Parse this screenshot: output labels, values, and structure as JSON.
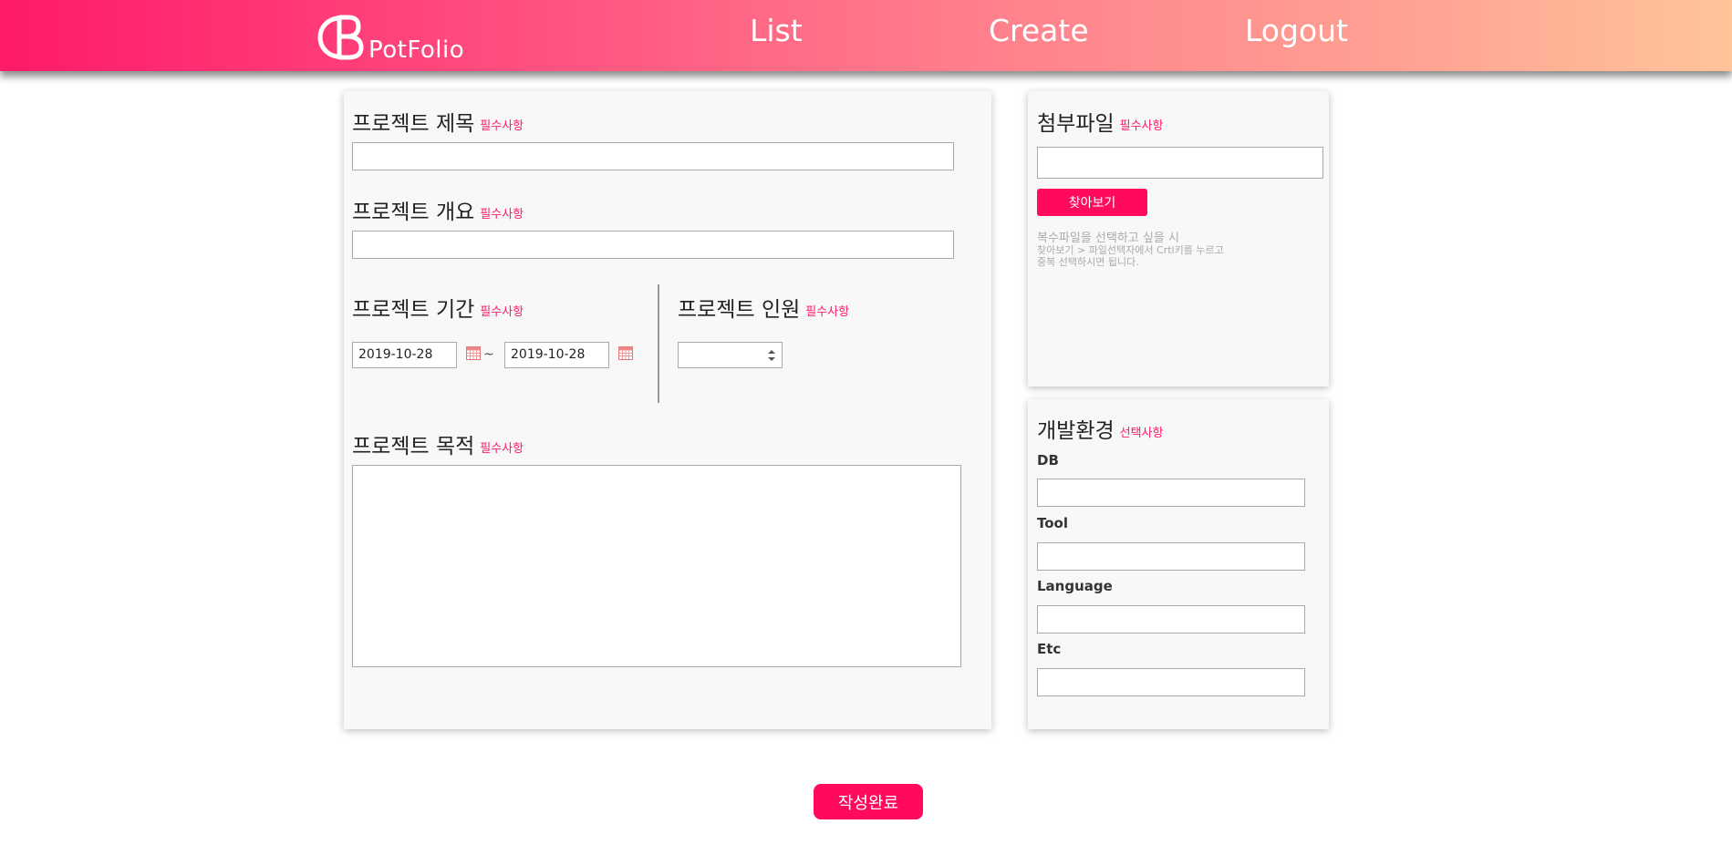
{
  "header": {
    "logo_text": "PotFolio",
    "nav": {
      "list": "List",
      "create": "Create",
      "logout": "Logout"
    }
  },
  "main": {
    "title": {
      "label": "프로젝트 제목",
      "tag": "필수사항",
      "value": ""
    },
    "overview": {
      "label": "프로젝트 개요",
      "tag": "필수사항",
      "value": ""
    },
    "period": {
      "label": "프로젝트 기간",
      "tag": "필수사항",
      "start": "2019-10-28",
      "separator": "~",
      "end": "2019-10-28"
    },
    "members": {
      "label": "프로젝트 인원",
      "tag": "필수사항",
      "value": ""
    },
    "purpose": {
      "label": "프로젝트 목적",
      "tag": "필수사항",
      "value": ""
    }
  },
  "attachment": {
    "label": "첨부파일",
    "tag": "필수사항",
    "value": "",
    "browse_label": "찾아보기",
    "hint_line1": "복수파일을 선택하고 싶을 시",
    "hint_line2": "찾아보기 > 파일선택자에서 Crtl키를 누르고",
    "hint_line3": "중복 선택하시면 됩니다."
  },
  "environment": {
    "label": "개발환경",
    "tag": "선택사항",
    "db_label": "DB",
    "db_value": "",
    "tool_label": "Tool",
    "tool_value": "",
    "language_label": "Language",
    "language_value": "",
    "etc_label": "Etc",
    "etc_value": ""
  },
  "submit_label": "작성완료",
  "colors": {
    "accent": "#ff0a5f",
    "gradient_start": "#ff1a6a",
    "gradient_end": "#ffc49a"
  }
}
